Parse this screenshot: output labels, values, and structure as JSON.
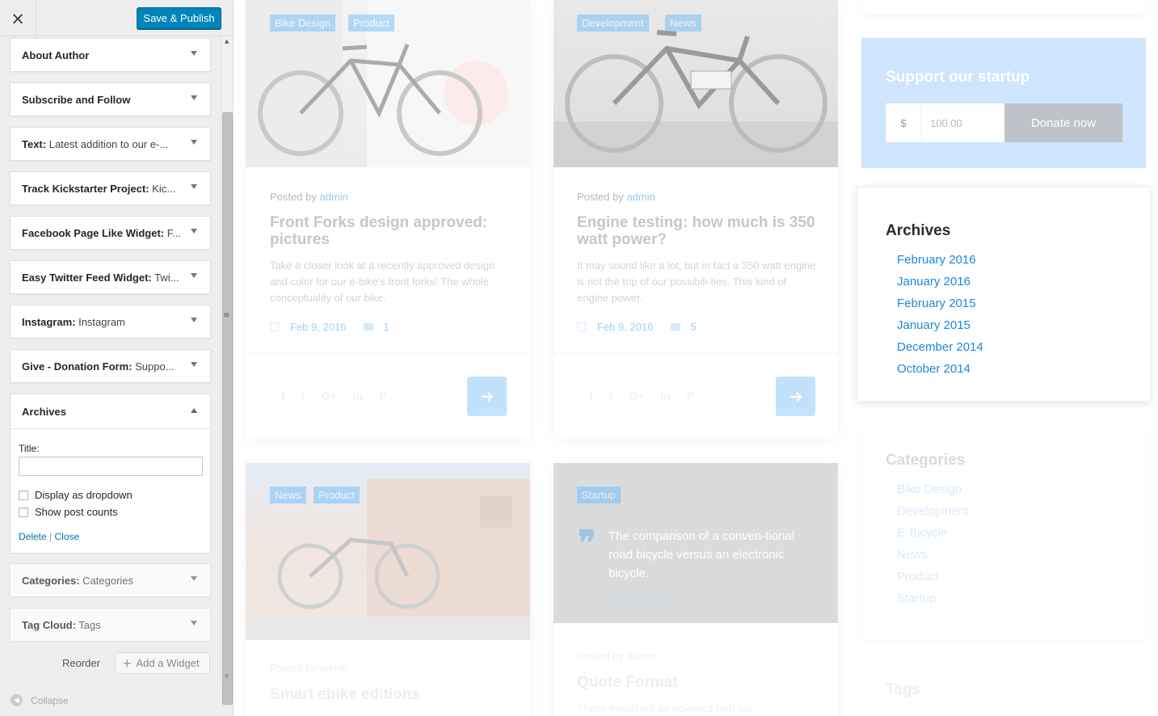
{
  "colors": {
    "publish_button": "#0085ba",
    "link_blue": "#0073aa",
    "archive_link": "#1e87d9",
    "donate_box": "#cfe5fd",
    "tag_badge": "#5fb8ff"
  },
  "customizer": {
    "close_icon": "×",
    "publish_label": "Save & Publish",
    "widgets": [
      {
        "name": "About Author",
        "subtitle": ""
      },
      {
        "name": "Subscribe and Follow",
        "subtitle": ""
      },
      {
        "name": "Text:",
        "subtitle": " Latest addition to our e-..."
      },
      {
        "name": "Track Kickstarter Project:",
        "subtitle": " Kic..."
      },
      {
        "name": "Facebook Page Like Widget:",
        "subtitle": " F..."
      },
      {
        "name": "Easy Twitter Feed Widget:",
        "subtitle": " Twi..."
      },
      {
        "name": "Instagram:",
        "subtitle": " Instagram"
      },
      {
        "name": "Give - Donation Form:",
        "subtitle": " Suppo..."
      }
    ],
    "widgets_after": [
      {
        "name": "Categories:",
        "subtitle": " Categories"
      },
      {
        "name": "Tag Cloud:",
        "subtitle": " Tags"
      }
    ],
    "archives_widget": {
      "name": "Archives",
      "title_label": "Title:",
      "title_value": "",
      "dropdown_label": "Display as dropdown",
      "postcounts_label": "Show post counts",
      "delete_label": "Delete",
      "separator": "|",
      "close_label": "Close"
    },
    "reorder_label": "Reorder",
    "add_widget_label": "Add a Widget",
    "collapse_label": "Collapse"
  },
  "posts": [
    {
      "tags": [
        "Bike Design",
        "Product"
      ],
      "posted_by": "Posted by",
      "author": "admin",
      "title": "Front Forks design approved: pictures",
      "excerpt": "Take a closer look at a recently approved design and color for our e-bike's front forks! The whole conceptuality of our bike.",
      "date": "Feb 9, 2016",
      "comments": "1"
    },
    {
      "tags": [
        "Development",
        "News"
      ],
      "posted_by": "Posted by",
      "author": "admin",
      "title": "Engine testing: how much is 350 watt power?",
      "excerpt": "It may sound like a lot, but in fact a 350 watt engine is not the top of our possibili-ties. This kind of engine power.",
      "date": "Feb 9, 2016",
      "comments": "5"
    },
    {
      "tags": [
        "News",
        "Product"
      ],
      "posted_by": "Posted by",
      "author": "admin",
      "title": "Smart ebike editions"
    },
    {
      "tags": [
        "Startup"
      ],
      "quote": "The comparison of a conven-tional road bicycle versus an electronic bicycle.",
      "quote_author": "- Shane Doe",
      "posted_by": "Posted by",
      "author": "admin",
      "title": "Quote Format",
      "excerpt": "These model will be powered with our"
    }
  ],
  "social_icons": [
    "facebook-icon",
    "twitter-icon",
    "google-plus-icon",
    "linkedin-icon",
    "pinterest-icon"
  ],
  "social_glyphs": [
    "f",
    "t",
    "G+",
    "in",
    "P"
  ],
  "donate": {
    "title": "Support our startup",
    "currency": "$",
    "amount": "100.00",
    "button": "Donate now"
  },
  "archives": {
    "title": "Archives",
    "items": [
      "February 2016",
      "January 2016",
      "February 2015",
      "January 2015",
      "December 2014",
      "October 2014"
    ]
  },
  "categories": {
    "title": "Categories",
    "items": [
      "Bike Design",
      "Development",
      "E-Bicycle",
      "News",
      "Product",
      "Startup"
    ]
  },
  "tags_title": "Tags"
}
